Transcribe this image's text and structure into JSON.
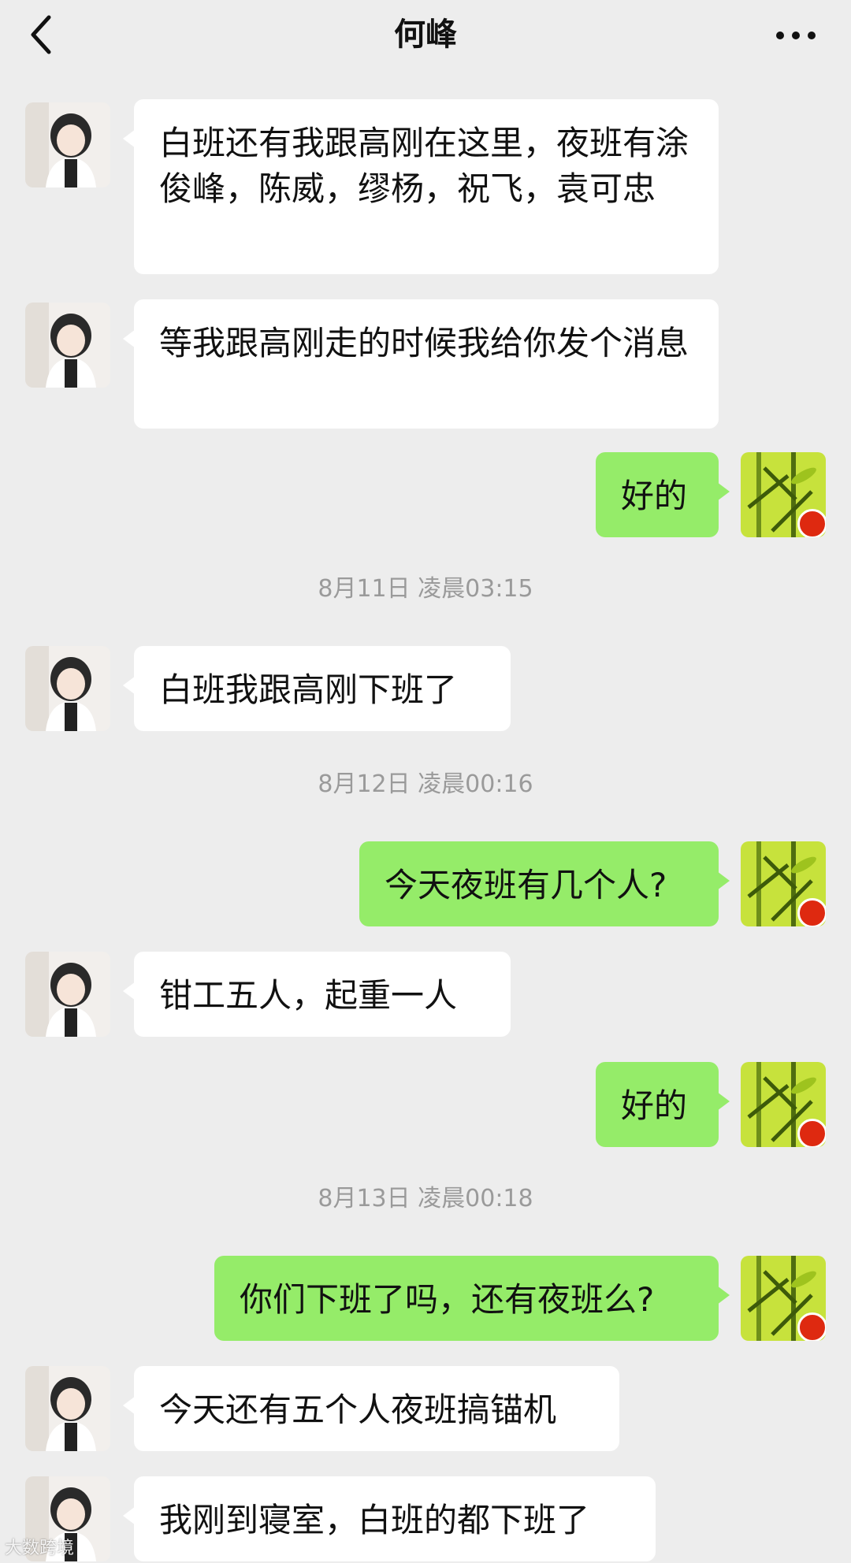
{
  "header": {
    "title": "何峰",
    "back_icon": "chevron-left-icon",
    "more_icon": "more-horizontal-icon"
  },
  "colors": {
    "background": "#ededed",
    "incoming_bubble": "#ffffff",
    "outgoing_bubble": "#95ec69",
    "timestamp_text": "#9a9a9a"
  },
  "messages": [
    {
      "type": "in",
      "text": "白班还有我跟高刚在这里，夜班有涂俊峰，陈威，缪杨，祝飞，袁可忠"
    },
    {
      "type": "in",
      "text": "等我跟高刚走的时候我给你发个消息"
    },
    {
      "type": "out",
      "text": "好的"
    },
    {
      "type": "time",
      "text": "8月11日 凌晨03:15"
    },
    {
      "type": "in",
      "text": "白班我跟高刚下班了"
    },
    {
      "type": "time",
      "text": "8月12日 凌晨00:16"
    },
    {
      "type": "out",
      "text": "今天夜班有几个人?"
    },
    {
      "type": "in",
      "text": "钳工五人，起重一人"
    },
    {
      "type": "out",
      "text": "好的"
    },
    {
      "type": "time",
      "text": "8月13日 凌晨00:18"
    },
    {
      "type": "out",
      "text": "你们下班了吗，还有夜班么?"
    },
    {
      "type": "in",
      "text": "今天还有五个人夜班搞锚机"
    },
    {
      "type": "in",
      "text": "我刚到寝室，白班的都下班了"
    }
  ],
  "watermark": "大数跨境"
}
